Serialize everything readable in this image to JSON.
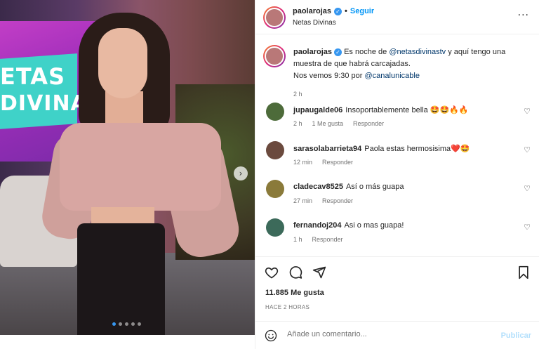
{
  "header": {
    "username": "paolarojas",
    "separator": "•",
    "follow_label": "Seguir",
    "subtitle": "Netas Divinas",
    "more_icon": "more-horizontal-icon"
  },
  "media": {
    "logo_line1": "ETAS",
    "logo_line2": "DIVINAS",
    "next_arrow": "›",
    "carousel_total": 5,
    "carousel_active": 1
  },
  "caption": {
    "username": "paolarojas",
    "text_part1": " Es noche de ",
    "mention1": "@netasdivinastv",
    "text_part2": " y aquí tengo una muestra de que habrá carcajadas.",
    "text_part3": "Nos vemos 9:30 por ",
    "mention2": "@canalunicable",
    "time": "2 h"
  },
  "comments": [
    {
      "username": "jupaugalde06",
      "text": "Insoportablemente bella 🤩🤩🔥🔥",
      "time": "2 h",
      "likes": "1 Me gusta",
      "reply": "Responder",
      "avatar_color": "#4d6b3a"
    },
    {
      "username": "sarasolabarrieta94",
      "text": "Paola estas hermosisima❤️🤩",
      "time": "12 min",
      "likes": "",
      "reply": "Responder",
      "avatar_color": "#6b4a3e"
    },
    {
      "username": "cladecav8525",
      "text": "Así o más guapa",
      "time": "27 min",
      "likes": "",
      "reply": "Responder",
      "avatar_color": "#8a7a3a"
    },
    {
      "username": "fernandoj204",
      "text": "Asi o mas guapa!",
      "time": "1 h",
      "likes": "",
      "reply": "Responder",
      "avatar_color": "#3c6a5a"
    }
  ],
  "actions": {
    "likes": "11.885 Me gusta",
    "ago": "HACE 2 HORAS",
    "icons": [
      "heart-icon",
      "comment-icon",
      "share-icon",
      "bookmark-icon"
    ]
  },
  "add_comment": {
    "placeholder": "Añade un comentario...",
    "post_label": "Publicar"
  }
}
